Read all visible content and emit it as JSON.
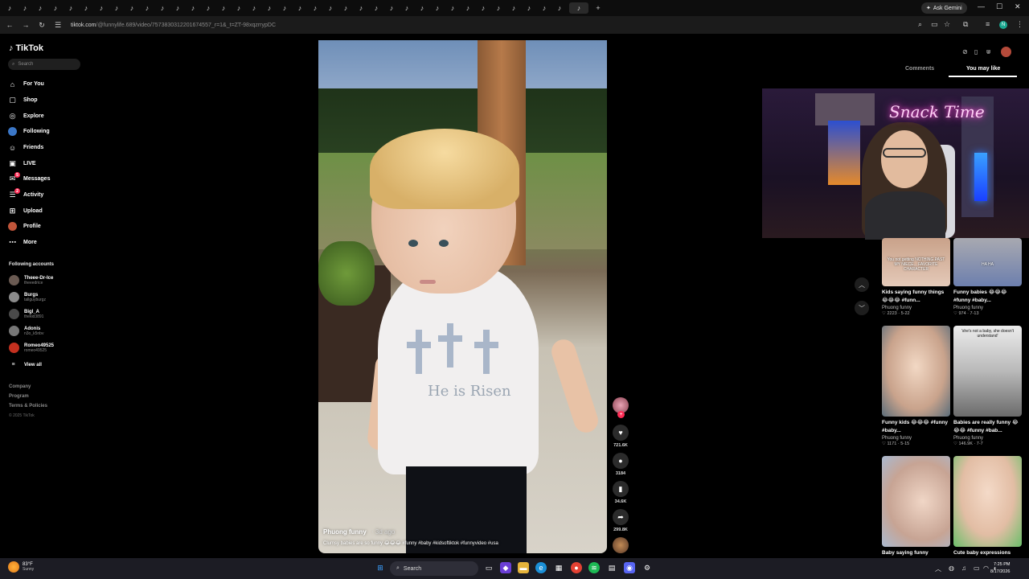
{
  "browser": {
    "ask_gemini": "Ask Gemini",
    "url_domain": "tiktok.com",
    "url_rest": "/@funnylife.689/video/7573830312201674557_r=1&_t=ZT-98xqzrrypDC"
  },
  "sidebar": {
    "logo": "TikTok",
    "search_placeholder": "Search",
    "nav": [
      {
        "label": "For You"
      },
      {
        "label": "Shop"
      },
      {
        "label": "Explore"
      },
      {
        "label": "Following"
      },
      {
        "label": "Friends"
      },
      {
        "label": "LIVE"
      },
      {
        "label": "Messages",
        "badge": "5"
      },
      {
        "label": "Activity",
        "badge": "2"
      },
      {
        "label": "Upload"
      },
      {
        "label": "Profile"
      },
      {
        "label": "More"
      }
    ],
    "following_title": "Following accounts",
    "accounts": [
      {
        "name": "Theee-Dr-Ice",
        "handle": "theeedrice"
      },
      {
        "name": "Burgs",
        "handle": "tallguyburgz"
      },
      {
        "name": "Bigl_A",
        "handle": "thekid3891"
      },
      {
        "name": "Adonis",
        "handle": "n3o_k5nbv"
      },
      {
        "name": "Romeo49525",
        "handle": "romeo49525"
      }
    ],
    "view_all": "View all",
    "footer_links": [
      "Company",
      "Program",
      "Terms & Policies"
    ],
    "copyright": "© 2025 TikTok"
  },
  "video": {
    "author": "Phuong funny",
    "posted": "3d ago",
    "caption": "Clumsy babies are so funny 😂😂😂 #funny #baby #kidsoftiktok #funnyvideo #usa",
    "shirt_text": "He is Risen"
  },
  "actions": {
    "likes": "721.6K",
    "comments": "3184",
    "saves": "34.6K",
    "shares": "299.8K"
  },
  "panel": {
    "tabs": [
      "Comments",
      "You may like"
    ],
    "active_tab": "You may like",
    "overlay_sign": "Snack Time"
  },
  "recommendations": [
    {
      "title": "Kids saying funny things 😂😂😂 #funn...",
      "author": "Phuong funny",
      "likes": "2223",
      "date": "5-22",
      "overlay": "You not getting NOTHING PAST MY NIECE... FAVORITE CHARACTER"
    },
    {
      "title": "Funny babies 😂😂😂 #funny #baby...",
      "author": "Phuong funny",
      "likes": "974",
      "date": "7-13",
      "overlay": "HA HA"
    },
    {
      "title": "Funny kids 😂😂😂 #funny #baby...",
      "author": "Phuong funny",
      "likes": "1171",
      "date": "5-15",
      "overlay": ""
    },
    {
      "title": "Babies are really funny 😂😂😂 #funny #bab...",
      "author": "Phuong funny",
      "likes": "146.9K",
      "date": "7-7",
      "overlay": "'she's not a baby, she doesn't understand'"
    },
    {
      "title": "Baby saying funny",
      "author": "",
      "likes": "",
      "date": "",
      "overlay": ""
    },
    {
      "title": "Cute baby expressions",
      "author": "",
      "likes": "",
      "date": "",
      "overlay": ""
    }
  ],
  "taskbar": {
    "temp": "83°F",
    "condition": "Sunny",
    "search": "Search",
    "time": "7:25 PM",
    "date": "8/17/2026"
  },
  "colors": {
    "accent": "#fe2c55",
    "background": "#000000",
    "muted_text": "#8a8a8a"
  }
}
